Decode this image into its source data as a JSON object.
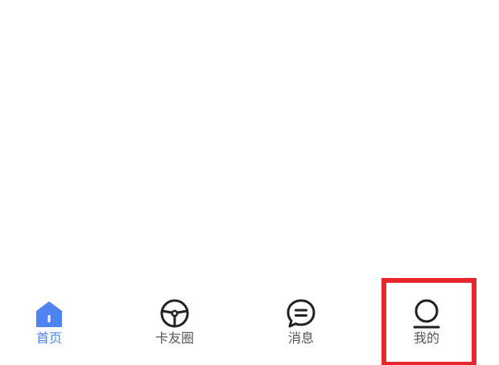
{
  "tabbar": {
    "tabs": [
      {
        "id": "home",
        "label": "首页",
        "icon": "home-icon",
        "active": true
      },
      {
        "id": "circle",
        "label": "卡友圈",
        "icon": "steering-wheel-icon",
        "active": false
      },
      {
        "id": "messages",
        "label": "消息",
        "icon": "chat-bubble-icon",
        "active": false
      },
      {
        "id": "mine",
        "label": "我的",
        "icon": "user-icon",
        "active": false
      }
    ]
  },
  "annotation": {
    "highlight_target": "mine",
    "highlight_color": "#e8262d"
  },
  "colors": {
    "active": "#4d84f1",
    "inactive": "#555555",
    "icon": "#222222"
  }
}
